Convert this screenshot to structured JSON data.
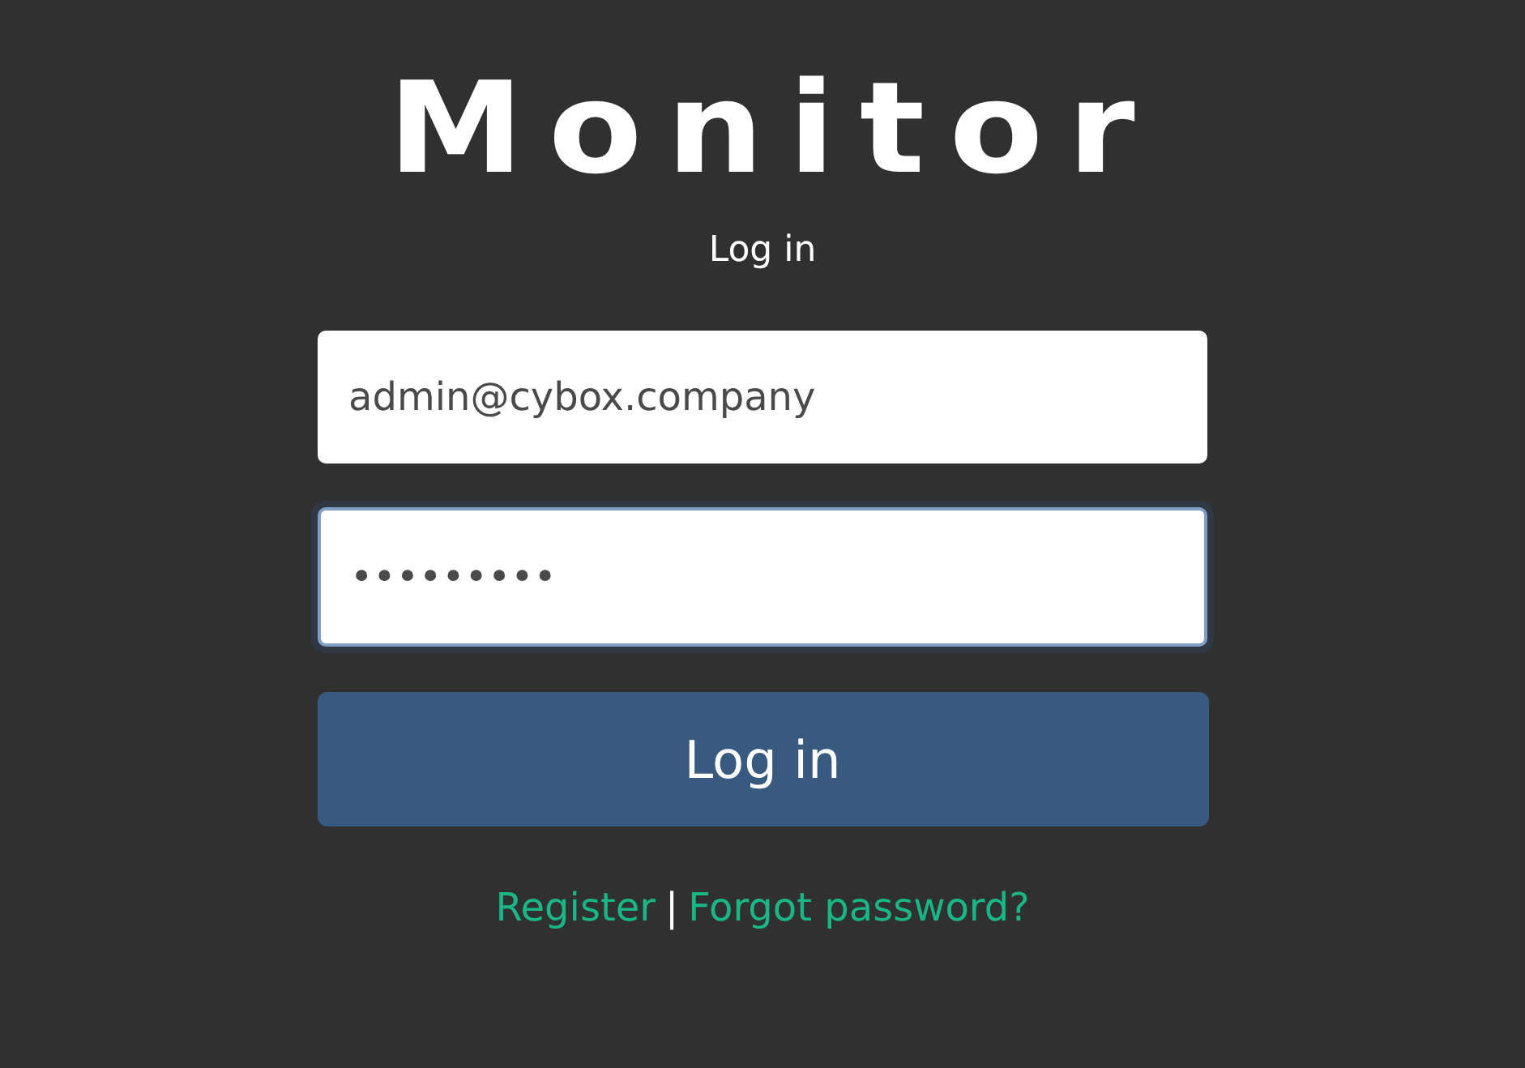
{
  "logo": {
    "text": "Monitor"
  },
  "heading": "Log in",
  "fields": [
    {
      "value": "admin@cybox.company",
      "focused": false
    },
    {
      "value": "•••••••••",
      "focused": true
    }
  ],
  "submit": {
    "label": "Log in"
  },
  "links": [
    {
      "label": "Register"
    },
    {
      "label": "Forgot password?"
    }
  ],
  "separator": "|"
}
